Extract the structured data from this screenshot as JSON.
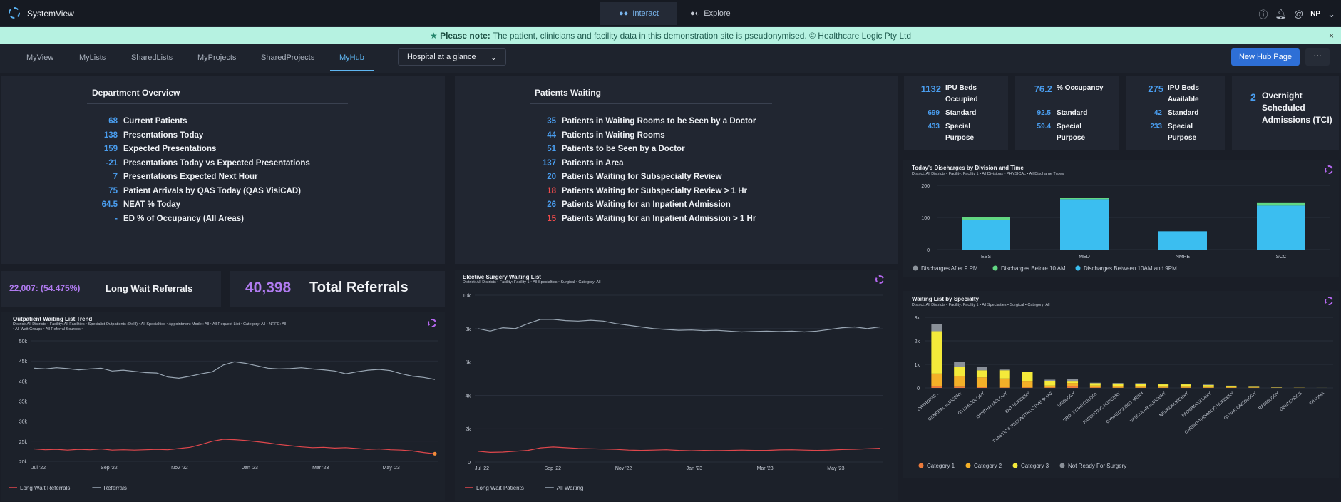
{
  "app": {
    "title": "SystemView",
    "modes": [
      "Interact",
      "Explore"
    ],
    "user": "NP"
  },
  "notice": {
    "label": "Please note:",
    "text": "The patient, clinicians and facility data in this demonstration site is pseudonymised. © Healthcare Logic Pty Ltd",
    "close": "×"
  },
  "nav": {
    "tabs": [
      "MyView",
      "MyLists",
      "SharedLists",
      "MyProjects",
      "SharedProjects",
      "MyHub"
    ],
    "hub_select": "Hospital at a glance",
    "new_hub": "New Hub Page",
    "more": "···"
  },
  "dept": {
    "title": "Department Overview",
    "rows": [
      {
        "value": "68",
        "label": "Current Patients"
      },
      {
        "value": "138",
        "label": "Presentations Today"
      },
      {
        "value": "159",
        "label": "Expected Presentations"
      },
      {
        "value": "-21",
        "label": "Presentations Today vs Expected Presentations"
      },
      {
        "value": "7",
        "label": "Presentations Expected Next Hour"
      },
      {
        "value": "75",
        "label": "Patient Arrivals by QAS Today (QAS VisiCAD)"
      },
      {
        "value": "64.5",
        "label": "NEAT % Today"
      },
      {
        "value": "-",
        "label": "ED % of Occupancy (All Areas)"
      }
    ]
  },
  "waiting": {
    "title": "Patients Waiting",
    "rows": [
      {
        "value": "35",
        "label": "Patients in Waiting Rooms to be Seen by a Doctor",
        "alert": false
      },
      {
        "value": "44",
        "label": "Patients in Waiting Rooms",
        "alert": false
      },
      {
        "value": "51",
        "label": "Patients to be Seen by a Doctor",
        "alert": false
      },
      {
        "value": "137",
        "label": "Patients in Area",
        "alert": false
      },
      {
        "value": "20",
        "label": "Patients Waiting for Subspecialty Review",
        "alert": false
      },
      {
        "value": "18",
        "label": "Patients Waiting for Subspecialty Review > 1 Hr",
        "alert": true
      },
      {
        "value": "26",
        "label": "Patients Waiting for an Inpatient Admission",
        "alert": false
      },
      {
        "value": "15",
        "label": "Patients Waiting for an Inpatient Admission > 1 Hr",
        "alert": true
      }
    ]
  },
  "beds": [
    {
      "big": "1132",
      "title": "IPU Beds Occupied",
      "r1v": "699",
      "r1l": "Standard",
      "r2v": "433",
      "r2l": "Special Purpose"
    },
    {
      "big": "76.2",
      "title": "% Occupancy",
      "r1v": "92.5",
      "r1l": "Standard",
      "r2v": "59.4",
      "r2l": "Special Purpose"
    },
    {
      "big": "275",
      "title": "IPU Beds Available",
      "r1v": "42",
      "r1l": "Standard",
      "r2v": "233",
      "r2l": "Special Purpose"
    }
  ],
  "overnight": {
    "value": "2",
    "label": "Overnight Scheduled Admissions (TCI)"
  },
  "referrals": {
    "long_wait": "22,007: (54.475%)",
    "long_wait_label": "Long Wait Referrals",
    "total": "40,398",
    "total_label": "Total Referrals"
  },
  "colors": {
    "accent": "#4a9ef0",
    "alert": "#f04b4b",
    "red_line": "#e0474c",
    "grey_line": "#9aa7b4",
    "cat1": "#ec7a3b",
    "cat2": "#f3b028",
    "cat3": "#f4ea3a",
    "notready": "#8a9098",
    "after9": "#8d949c",
    "before10": "#62d783",
    "between": "#3bbef0"
  },
  "discharge": {
    "title": "Today's Discharges by Division and Time",
    "subtitle": "District: All Districts  •  Facility: Facility 1  •  All Divisions  •  PHYSICAL  •  All Discharge Types"
  },
  "specialty": {
    "title": "Waiting List by Specialty",
    "subtitle": "District: All Districts  •  Facility: Facility 1  •  All Specialties  •  Surgical  •  Category: All"
  },
  "outpatient": {
    "title": "Outpatient Waiting List Trend",
    "subtitle1": "District: All Districts  •  Facility: All Facilities  •  Specialist Outpatients (DoH)  •  All Specialties  •  Appointment Mode : All  •  All Request List  •  Category: All  •  NRFC: All",
    "subtitle2": "•  All Wait Groups  •  All Referral Sources  •"
  },
  "elective": {
    "title": "Elective Surgery Waiting List",
    "subtitle": "District: All Districts  •  Facility: Facility 1  •  All Specialties  •  Surgical  •  Category: All"
  },
  "chart_data": [
    {
      "type": "bar",
      "stacked": true,
      "categories": [
        "ESS",
        "MED",
        "NMPE",
        "SCC"
      ],
      "series": [
        {
          "name": "Discharges After 9 PM",
          "values": [
            0,
            0,
            0,
            0
          ]
        },
        {
          "name": "Discharges Before 10 AM",
          "values": [
            8,
            5,
            0,
            10
          ]
        },
        {
          "name": "Discharges Between 10AM and 9PM",
          "values": [
            92,
            157,
            57,
            137
          ]
        }
      ],
      "ylim": [
        0,
        200
      ],
      "yticks": [
        "200",
        "100",
        "0"
      ],
      "legend": "bottom"
    },
    {
      "type": "bar",
      "stacked": true,
      "categories": [
        "ORTHOPAE...",
        "GENERAL SURGERY",
        "GYNAECOLOGY",
        "OPHTHALMOLOGY",
        "ENT SURGERY",
        "PLASTIC & RECONSTRUCTIVE SURG",
        "UROLOGY",
        "URO GYNAECOLOGY",
        "PAEDIATRIC SURGERY",
        "GYNAECOLOGY MESH",
        "VASCULAR SURGERY",
        "NEUROSURGERY",
        "FACIOMAXILLARY",
        "CARDIO-THORACIC SURGERY",
        "GYNAE ONCOLOGY",
        "RADIOLOGY",
        "OBSTETRICS",
        "TRAUMA"
      ],
      "series": [
        {
          "name": "Category 1",
          "values": [
            60,
            50,
            30,
            20,
            20,
            20,
            60,
            20,
            10,
            10,
            10,
            10,
            10,
            5,
            5,
            0,
            0,
            0
          ]
        },
        {
          "name": "Category 2",
          "values": [
            550,
            450,
            420,
            380,
            250,
            80,
            150,
            80,
            60,
            50,
            40,
            40,
            30,
            30,
            20,
            10,
            5,
            0
          ]
        },
        {
          "name": "Category 3",
          "values": [
            1800,
            400,
            300,
            350,
            400,
            200,
            60,
            100,
            120,
            100,
            100,
            100,
            80,
            40,
            20,
            10,
            5,
            2
          ]
        },
        {
          "name": "Not Ready For Surgery",
          "values": [
            300,
            200,
            150,
            30,
            20,
            50,
            100,
            20,
            20,
            40,
            30,
            20,
            20,
            20,
            5,
            5,
            0,
            0
          ]
        }
      ],
      "ylim": [
        0,
        3000
      ],
      "yticks": [
        "3k",
        "2k",
        "1k",
        "0"
      ],
      "legend": "bottom"
    },
    {
      "type": "line",
      "x": [
        "Jul '22",
        "Sep '22",
        "Nov '22",
        "Jan '23",
        "Mar '23",
        "May '23"
      ],
      "ylim": [
        20000,
        50000
      ],
      "yticks": [
        "50k",
        "45k",
        "40k",
        "35k",
        "30k",
        "25k",
        "20k"
      ],
      "series": [
        {
          "name": "Referrals",
          "values": [
            43200,
            43000,
            43300,
            43100,
            42800,
            43000,
            43200,
            42500,
            42700,
            42400,
            42100,
            42000,
            41000,
            40700,
            41200,
            41800,
            42300,
            44000,
            44800,
            44400,
            43800,
            43200,
            43000,
            43100,
            43300,
            43000,
            42800,
            42500,
            41800,
            42300,
            42700,
            42900,
            42600,
            41800,
            41200,
            40900,
            40400
          ]
        },
        {
          "name": "Long Wait Referrals",
          "values": [
            23100,
            22900,
            23000,
            22800,
            23000,
            22900,
            23100,
            22800,
            22900,
            22800,
            22900,
            23000,
            22900,
            23200,
            23500,
            24200,
            25000,
            25500,
            25400,
            25200,
            24900,
            24600,
            24200,
            23900,
            23600,
            23400,
            23500,
            23300,
            23400,
            23200,
            23000,
            23100,
            22900,
            22800,
            22600,
            22200,
            21900
          ]
        }
      ],
      "legend": "bottom"
    },
    {
      "type": "line",
      "x": [
        "Jul '22",
        "Sep '22",
        "Nov '22",
        "Jan '23",
        "Mar '23",
        "May '23"
      ],
      "ylim": [
        0,
        10000
      ],
      "yticks": [
        "10k",
        "8k",
        "6k",
        "4k",
        "2k",
        "0"
      ],
      "series": [
        {
          "name": "All Waiting",
          "values": [
            8000,
            7850,
            8050,
            8000,
            8300,
            8550,
            8550,
            8480,
            8450,
            8500,
            8450,
            8300,
            8200,
            8100,
            8000,
            7950,
            7900,
            7920,
            7880,
            7900,
            7850,
            7800,
            7830,
            7850,
            7820,
            7850,
            7800,
            7850,
            7950,
            8050,
            8100,
            8000,
            8100
          ]
        },
        {
          "name": "Long Wait Patients",
          "values": [
            650,
            580,
            600,
            650,
            700,
            850,
            900,
            860,
            820,
            800,
            780,
            760,
            720,
            700,
            720,
            740,
            700,
            680,
            700,
            690,
            700,
            720,
            700,
            700,
            730,
            740,
            720,
            700,
            720,
            750,
            770,
            800,
            830
          ]
        }
      ],
      "legend": "bottom"
    }
  ]
}
